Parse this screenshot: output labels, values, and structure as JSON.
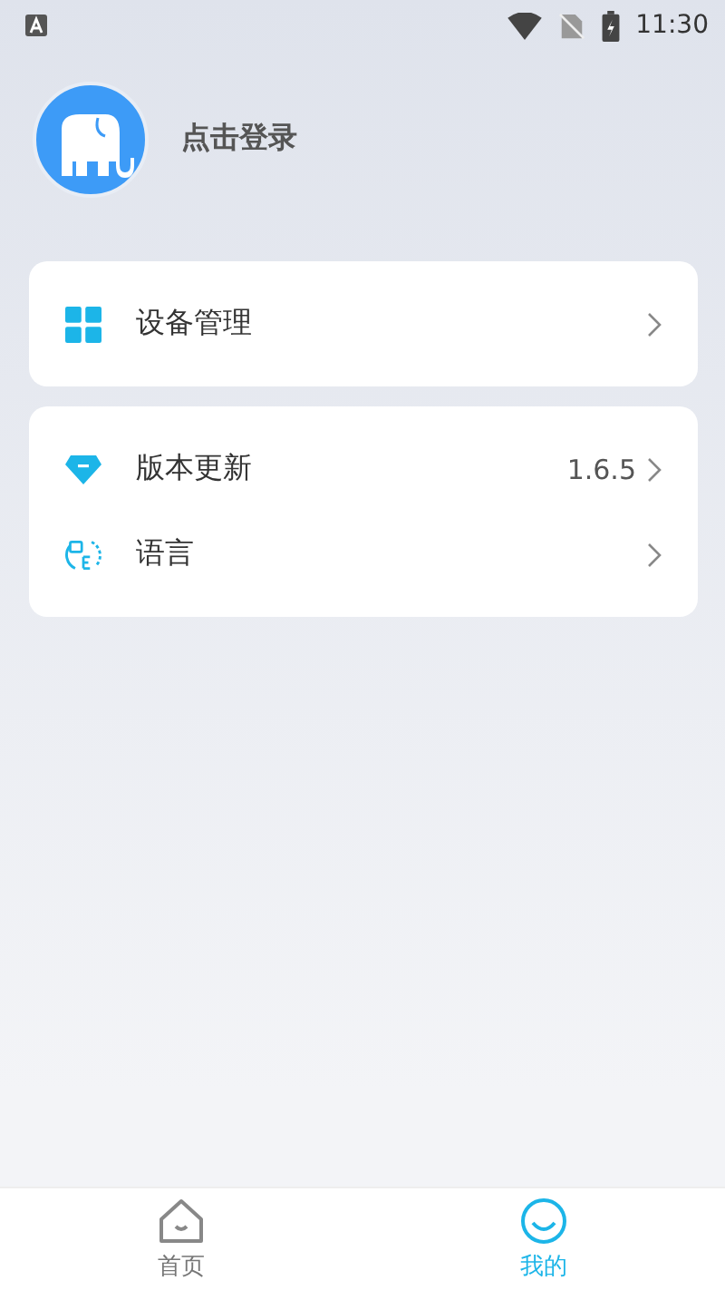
{
  "status_bar": {
    "time": "11:30"
  },
  "profile": {
    "login_text": "点击登录"
  },
  "cards": [
    {
      "items": [
        {
          "kind": "devices",
          "label": "设备管理"
        }
      ]
    },
    {
      "items": [
        {
          "kind": "version",
          "label": "版本更新",
          "value": "1.6.5"
        },
        {
          "kind": "language",
          "label": "语言"
        }
      ]
    }
  ],
  "tab_bar": [
    {
      "kind": "home",
      "label": "首页",
      "selected": false
    },
    {
      "kind": "mine",
      "label": "我的",
      "selected": true
    }
  ]
}
